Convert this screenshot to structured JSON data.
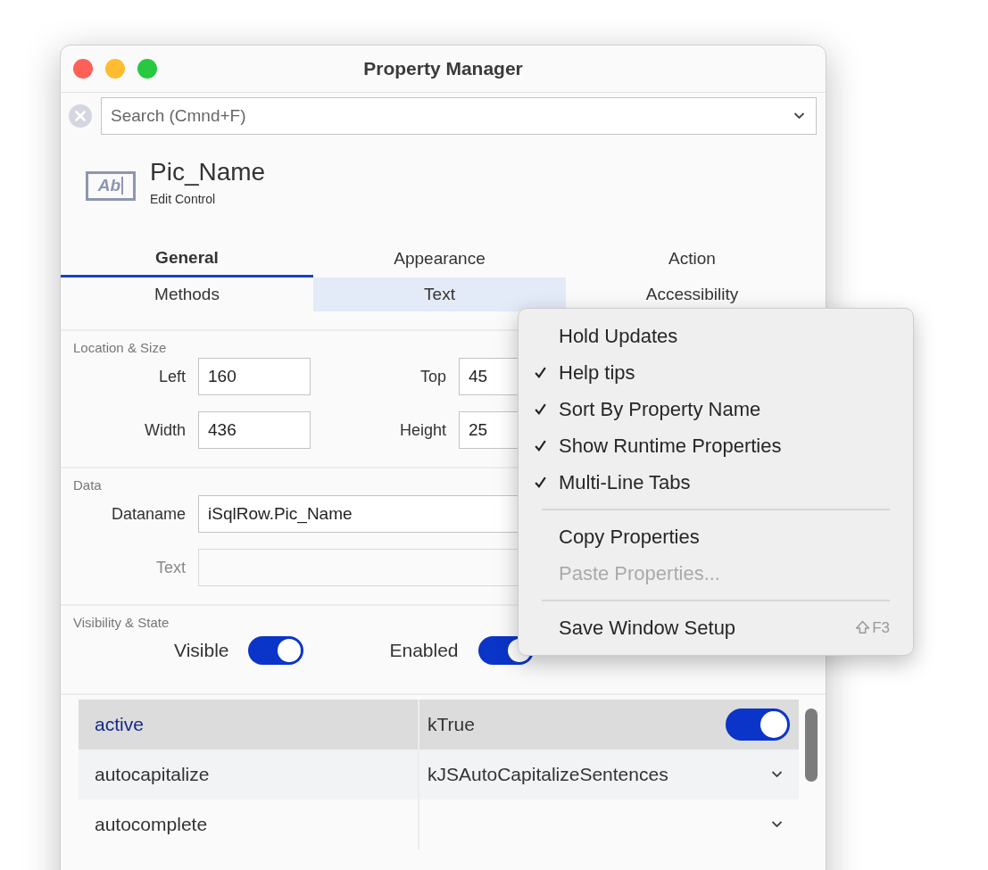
{
  "window": {
    "title": "Property Manager"
  },
  "search": {
    "placeholder": "Search (Cmnd+F)"
  },
  "object": {
    "name": "Pic_Name",
    "type": "Edit Control",
    "icon_text": "Ab"
  },
  "tabs": [
    {
      "label": "General",
      "selected": true,
      "highlighted": false
    },
    {
      "label": "Appearance",
      "selected": false,
      "highlighted": false
    },
    {
      "label": "Action",
      "selected": false,
      "highlighted": false
    },
    {
      "label": "Methods",
      "selected": false,
      "highlighted": false
    },
    {
      "label": "Text",
      "selected": false,
      "highlighted": true
    },
    {
      "label": "Accessibility",
      "selected": false,
      "highlighted": false
    }
  ],
  "location": {
    "title": "Location & Size",
    "fields": [
      {
        "label": "Left",
        "value": "160"
      },
      {
        "label": "Top",
        "value": "45"
      },
      {
        "label": "Width",
        "value": "436"
      },
      {
        "label": "Height",
        "value": "25"
      }
    ]
  },
  "data": {
    "title": "Data",
    "fields": [
      {
        "label": "Dataname",
        "value": "iSqlRow.Pic_Name",
        "disabled": false
      },
      {
        "label": "Text",
        "disabled": true
      }
    ]
  },
  "visibility": {
    "title": "Visibility & State",
    "toggles": [
      {
        "label": "Visible",
        "on": true
      },
      {
        "label": "Enabled",
        "on": true
      }
    ]
  },
  "properties": [
    {
      "name": "active",
      "value": "kTrue",
      "kind": "toggle",
      "on": true,
      "selected": true
    },
    {
      "name": "autocapitalize",
      "value": "kJSAutoCapitalizeSentences",
      "kind": "dropdown",
      "selected": false
    },
    {
      "name": "autocomplete",
      "kind": "dropdown",
      "selected": false
    }
  ],
  "context_menu": [
    {
      "kind": "item",
      "label": "Hold Updates",
      "checked": false,
      "disabled": false
    },
    {
      "kind": "item",
      "label": "Help tips",
      "checked": true,
      "disabled": false
    },
    {
      "kind": "item",
      "label": "Sort By Property Name",
      "checked": true,
      "disabled": false
    },
    {
      "kind": "item",
      "label": "Show Runtime Properties",
      "checked": true,
      "disabled": false
    },
    {
      "kind": "item",
      "label": "Multi-Line Tabs",
      "checked": true,
      "disabled": false
    },
    {
      "kind": "separator"
    },
    {
      "kind": "item",
      "label": "Copy Properties",
      "checked": false,
      "disabled": false
    },
    {
      "kind": "item",
      "label": "Paste Properties...",
      "checked": false,
      "disabled": true
    },
    {
      "kind": "separator"
    },
    {
      "kind": "item",
      "label": "Save Window Setup",
      "checked": false,
      "disabled": false,
      "shortcut": "F3"
    }
  ]
}
